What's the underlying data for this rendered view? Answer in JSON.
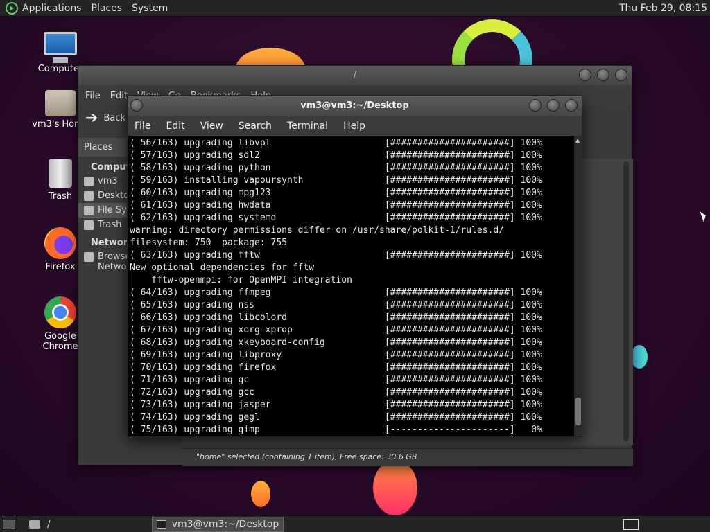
{
  "top_panel": {
    "menus": [
      "Applications",
      "Places",
      "System"
    ],
    "clock": "Thu Feb 29, 08:15"
  },
  "desktop_icons": [
    {
      "label": "Computer",
      "icon": "computer-icon"
    },
    {
      "label": "vm3's Home",
      "icon": "home-folder-icon"
    },
    {
      "label": "Trash",
      "icon": "trash-icon"
    },
    {
      "label": "Firefox",
      "icon": "firefox-icon"
    },
    {
      "label": "Google Chrome",
      "icon": "chrome-icon"
    }
  ],
  "file_manager": {
    "title": "/",
    "menus": [
      "File",
      "Edit",
      "View",
      "Go",
      "Bookmarks",
      "Help"
    ],
    "back_label": "Back",
    "side_header": "Places",
    "side_categories": [
      {
        "label": "Computer",
        "items": [
          {
            "label": "vm3",
            "selected": false
          },
          {
            "label": "Desktop",
            "selected": false
          },
          {
            "label": "File System",
            "selected": true
          },
          {
            "label": "Trash",
            "selected": false
          }
        ]
      },
      {
        "label": "Network",
        "items": [
          {
            "label": "Browse Network",
            "selected": false
          }
        ]
      }
    ],
    "status": "\"home\" selected (containing 1 item), Free space: 30.6 GB"
  },
  "terminal": {
    "title": "vm3@vm3:~/Desktop",
    "menus": [
      "File",
      "Edit",
      "View",
      "Search",
      "Terminal",
      "Help"
    ],
    "lines": [
      "( 56/163) upgrading libvpl                     [######################] 100%",
      "( 57/163) upgrading sdl2                       [######################] 100%",
      "( 58/163) upgrading python                     [######################] 100%",
      "( 59/163) installing vapoursynth               [######################] 100%",
      "( 60/163) upgrading mpg123                     [######################] 100%",
      "( 61/163) upgrading hwdata                     [######################] 100%",
      "( 62/163) upgrading systemd                    [######################] 100%",
      "warning: directory permissions differ on /usr/share/polkit-1/rules.d/",
      "filesystem: 750  package: 755",
      "( 63/163) upgrading fftw                       [######################] 100%",
      "New optional dependencies for fftw",
      "    fftw-openmpi: for OpenMPI integration",
      "( 64/163) upgrading ffmpeg                     [######################] 100%",
      "( 65/163) upgrading nss                        [######################] 100%",
      "( 66/163) upgrading libcolord                  [######################] 100%",
      "( 67/163) upgrading xorg-xprop                 [######################] 100%",
      "( 68/163) upgrading xkeyboard-config           [######################] 100%",
      "( 69/163) upgrading libproxy                   [######################] 100%",
      "( 70/163) upgrading firefox                    [######################] 100%",
      "( 71/163) upgrading gc                         [######################] 100%",
      "( 72/163) upgrading gcc                        [######################] 100%",
      "( 73/163) upgrading jasper                     [######################] 100%",
      "( 74/163) upgrading gegl                       [######################] 100%",
      "( 75/163) upgrading gimp                       [----------------------]   0%"
    ]
  },
  "taskbar": {
    "items": [
      {
        "label": "/",
        "active": false
      },
      {
        "label": "vm3@vm3:~/Desktop",
        "active": true
      }
    ]
  }
}
